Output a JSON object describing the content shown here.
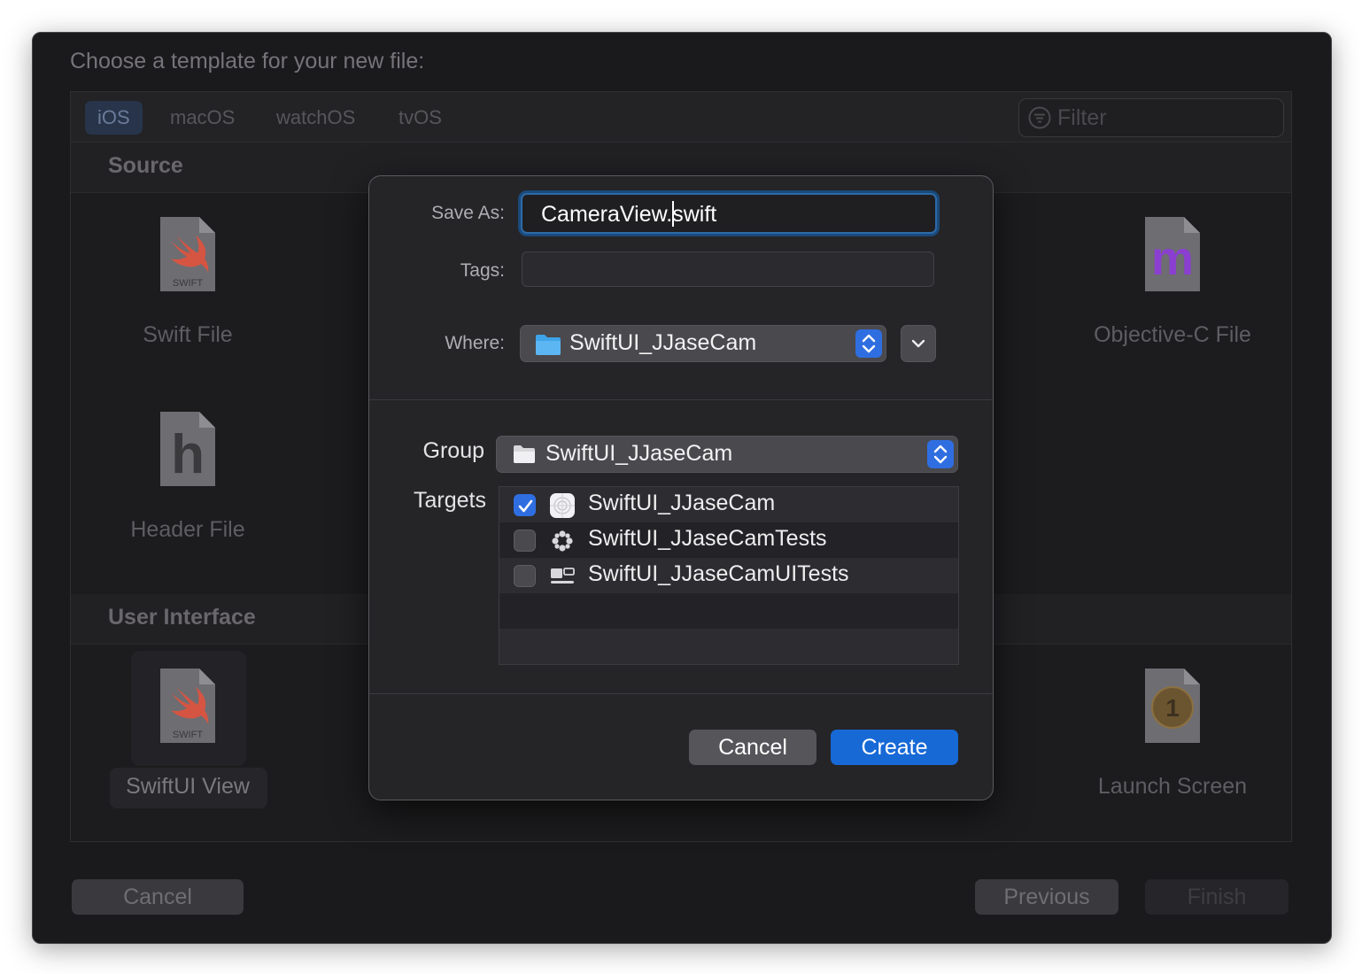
{
  "window": {
    "title": "Choose a template for your new file:",
    "platform_tabs": [
      "iOS",
      "macOS",
      "watchOS",
      "tvOS"
    ],
    "active_tab": "iOS",
    "filter_placeholder": "Filter",
    "sections": {
      "source": {
        "title": "Source",
        "items": [
          "Swift File",
          "Objective-C File",
          "Header File"
        ]
      },
      "user_interface": {
        "title": "User Interface",
        "items": [
          "SwiftUI View",
          "Launch Screen"
        ],
        "selected": "SwiftUI View"
      }
    },
    "icon_texts": {
      "swift": "SWIFT",
      "objc": "m",
      "header": "h",
      "launch": "1"
    },
    "buttons": {
      "cancel": "Cancel",
      "previous": "Previous",
      "finish": "Finish"
    }
  },
  "save_sheet": {
    "save_as_label": "Save As:",
    "save_as_value": "CameraView.swift",
    "tags_label": "Tags:",
    "tags_value": "",
    "where_label": "Where:",
    "where_value": "SwiftUI_JJaseCam",
    "group_label": "Group",
    "group_value": "SwiftUI_JJaseCam",
    "targets_label": "Targets",
    "targets": [
      {
        "name": "SwiftUI_JJaseCam",
        "checked": true,
        "icon": "app-icon"
      },
      {
        "name": "SwiftUI_JJaseCamTests",
        "checked": false,
        "icon": "tests-icon"
      },
      {
        "name": "SwiftUI_JJaseCamUITests",
        "checked": false,
        "icon": "ui-tests-icon"
      }
    ],
    "cancel_label": "Cancel",
    "create_label": "Create"
  },
  "colors": {
    "accent": "#2f6ee0",
    "create_button": "#1769d6",
    "swift_orange": "#e8513a",
    "objc_purple": "#8a3fd0"
  }
}
